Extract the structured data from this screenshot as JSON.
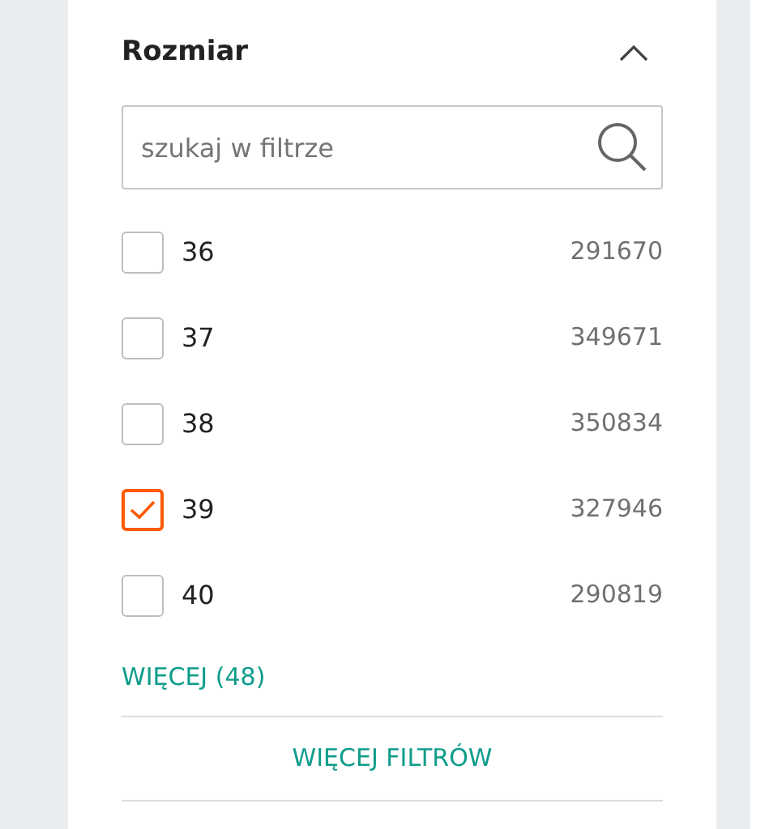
{
  "filter": {
    "title": "Rozmiar",
    "expanded": true,
    "search": {
      "placeholder": "szukaj w filtrze"
    },
    "options": [
      {
        "label": "36",
        "count": "291670",
        "checked": false
      },
      {
        "label": "37",
        "count": "349671",
        "checked": false
      },
      {
        "label": "38",
        "count": "350834",
        "checked": false
      },
      {
        "label": "39",
        "count": "327946",
        "checked": true
      },
      {
        "label": "40",
        "count": "290819",
        "checked": false
      }
    ],
    "more_link": "WIĘCEJ (48)"
  },
  "more_filters_button": "WIĘCEJ FILTRÓW"
}
